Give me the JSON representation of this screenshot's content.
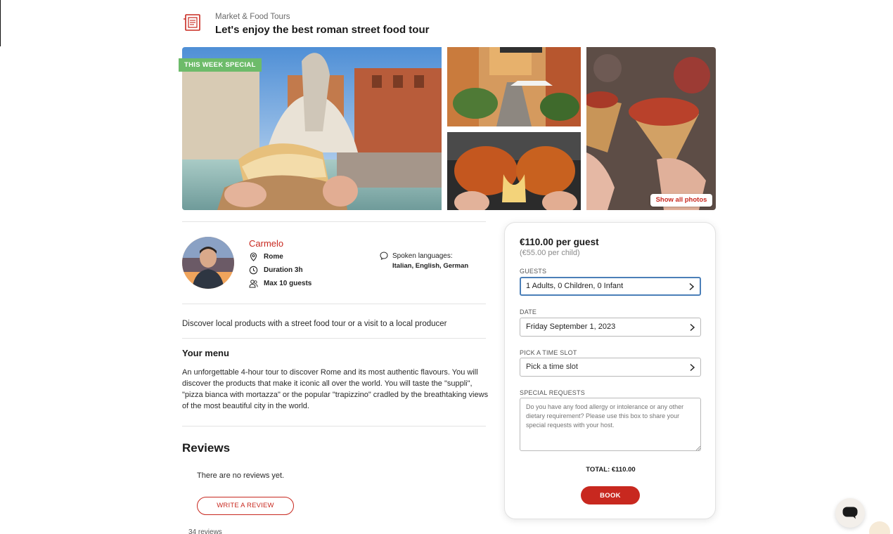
{
  "header": {
    "category": "Market & Food Tours",
    "title": "Let's enjoy the best roman street food tour",
    "icon": "market-menu-icon"
  },
  "gallery": {
    "badge": "THIS WEEK SPECIAL",
    "show_all_label": "Show all photos",
    "photos": [
      "fountain-focaccia-photo",
      "street-cafe-photo",
      "suppli-cheese-photo",
      "trapizzino-photo"
    ]
  },
  "host": {
    "name": "Carmelo",
    "location": "Rome",
    "duration": "Duration 3h",
    "max_guests": "Max 10 guests",
    "languages_label": "Spoken languages:",
    "languages": "Italian, English, German"
  },
  "description": {
    "summary": "Discover local products with a street food tour or a visit to a local producer",
    "menu_heading": "Your menu",
    "menu_text": "An unforgettable 4-hour tour to discover Rome and its most authentic flavours. You will discover the products that make it iconic all over the world. You will taste the \"suppli\", \"pizza bianca with mortazza\" or the popular \"trapizzino\" cradled by the breathtaking views of the most beautiful city in the world."
  },
  "reviews": {
    "heading": "Reviews",
    "empty_text": "There are no reviews yet.",
    "write_label": "WRITE A REVIEW",
    "count_label": "34 reviews"
  },
  "booking": {
    "price": "€110.00 per guest",
    "price_child": "(€55.00 per child)",
    "guests_label": "GUESTS",
    "guests_value": "1 Adults, 0 Children, 0 Infant",
    "date_label": "DATE",
    "date_value": "Friday September 1, 2023",
    "time_label": "PICK A TIME SLOT",
    "time_placeholder": "Pick a time slot",
    "requests_label": "SPECIAL REQUESTS",
    "requests_placeholder": "Do you have any food allergy or intolerance or any other dietary requirement? Please use this box to share your special requests with your host.",
    "total": "TOTAL: €110.00",
    "book_label": "BOOK"
  },
  "colors": {
    "accent": "#c8281f",
    "badge_green": "#6dbb6a",
    "focus_blue": "#4b7fb8"
  }
}
